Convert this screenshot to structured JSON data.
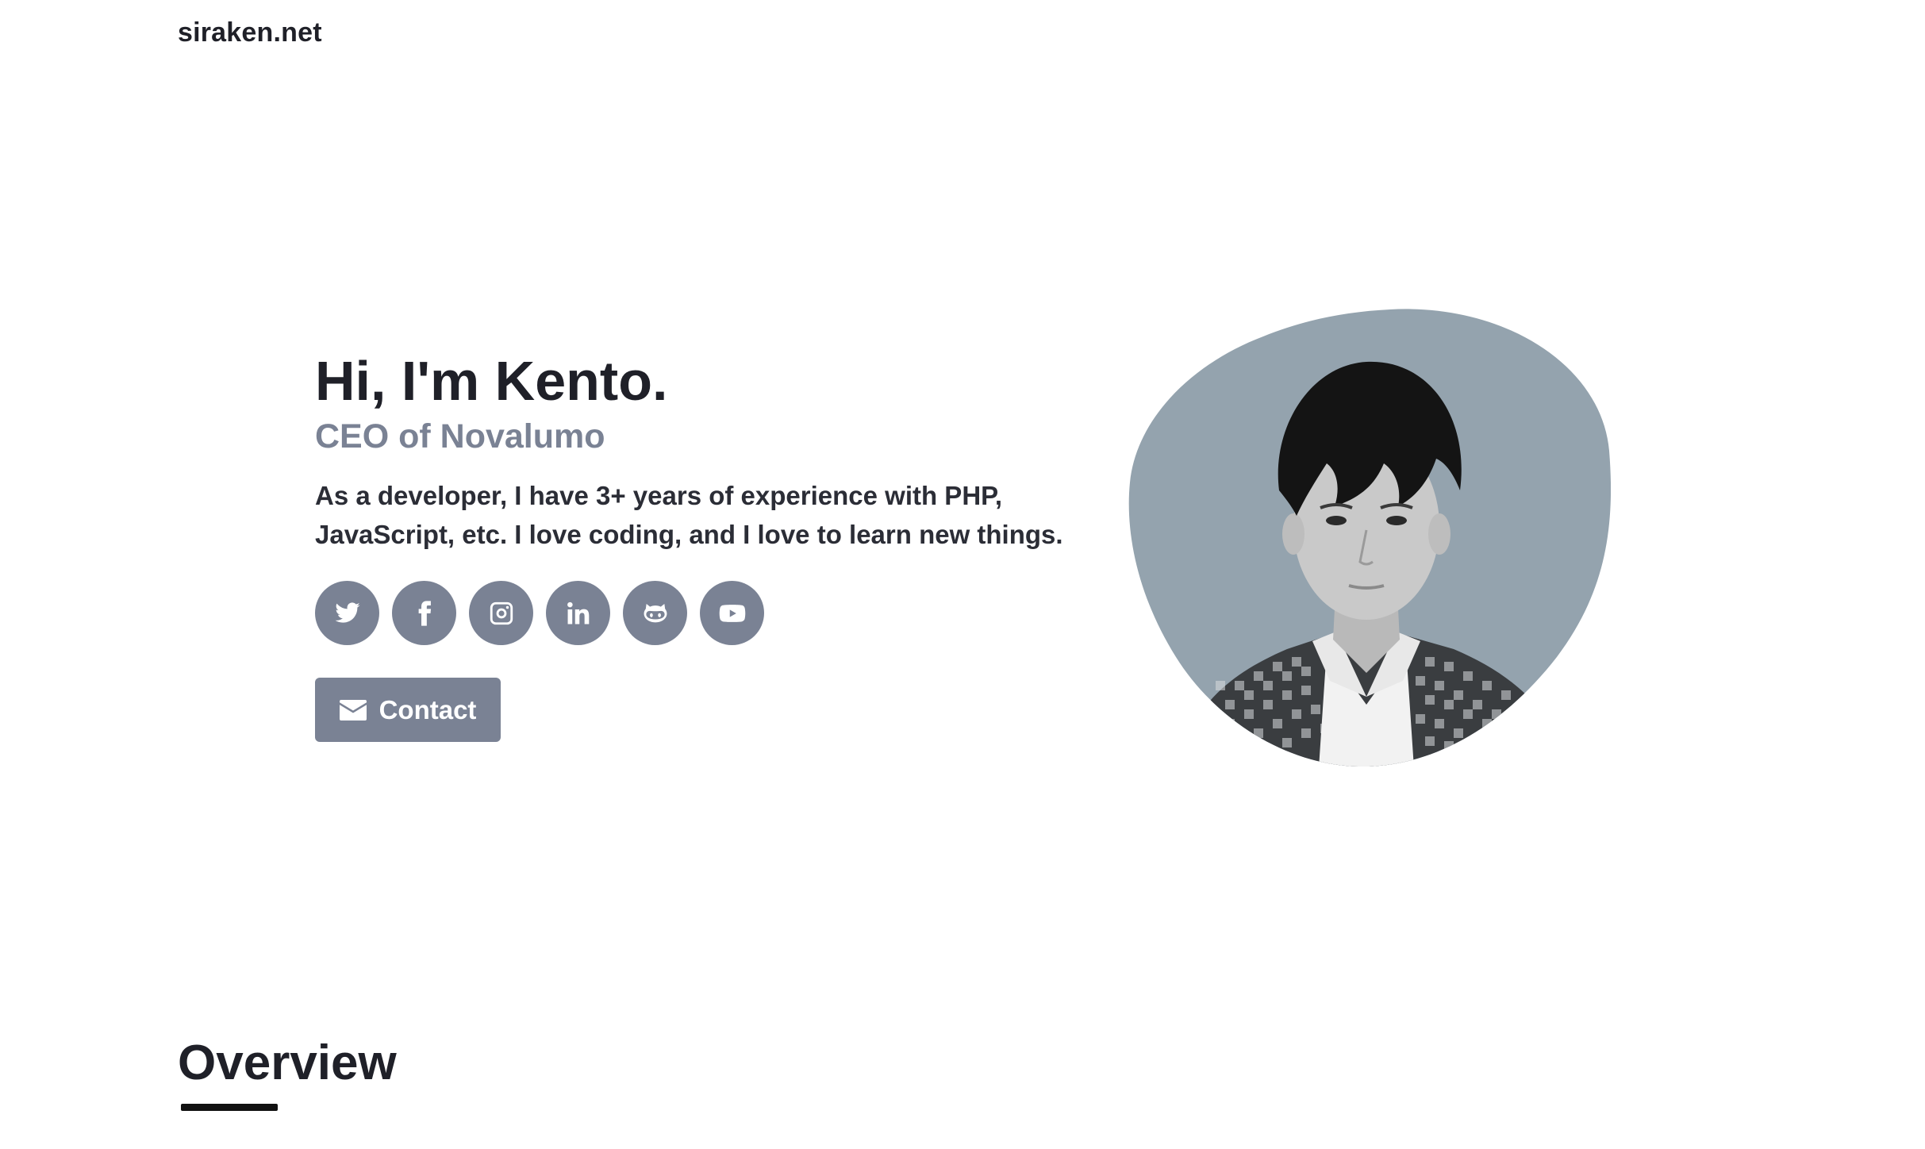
{
  "header": {
    "brand": "siraken.net"
  },
  "hero": {
    "title": "Hi, I'm Kento.",
    "subtitle": "CEO of Novalumo",
    "description": "As a developer, I have 3+ years of experience with PHP, JavaScript, etc. I love coding, and I love to learn new things.",
    "socials": [
      {
        "icon": "twitter-icon"
      },
      {
        "icon": "facebook-icon"
      },
      {
        "icon": "instagram-icon"
      },
      {
        "icon": "linkedin-icon"
      },
      {
        "icon": "github-icon"
      },
      {
        "icon": "youtube-icon"
      }
    ],
    "contact_label": "Contact",
    "accent_color": "#7a8294",
    "blob_color": "#94a3ae"
  },
  "sections": {
    "overview_title": "Overview"
  }
}
